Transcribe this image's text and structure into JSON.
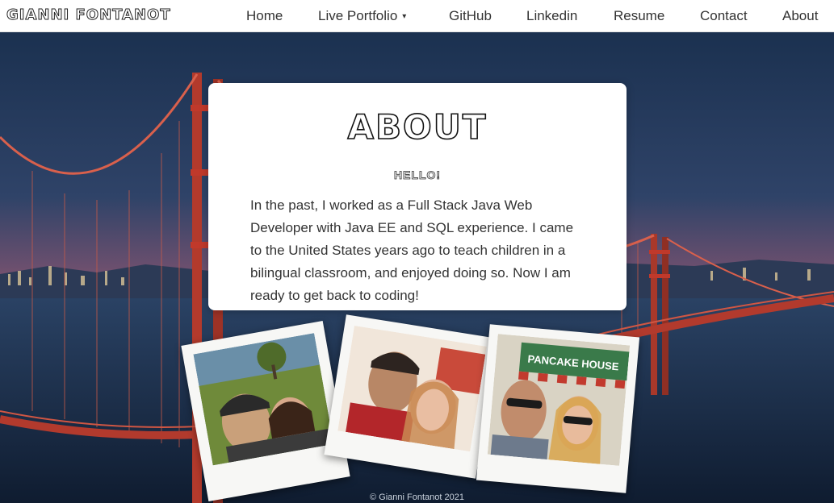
{
  "brand": "GIANNI FONTANOT",
  "nav": {
    "home": "Home",
    "portfolio": "Live Portfolio",
    "github": "GitHub",
    "linkedin": "Linkedin",
    "resume": "Resume",
    "contact": "Contact",
    "about": "About",
    "caret": "▾"
  },
  "about": {
    "title": "ABOUT",
    "greeting": "HELLO!",
    "body": "In the past, I worked as a Full Stack Java Web Developer with Java EE and SQL experience. I came to the United States years ago to teach children in a bilingual classroom, and enjoyed doing so. Now I am ready to get back to coding!"
  },
  "photos": {
    "third_sign": "PANCAKE HOUSE"
  },
  "footer": "© Gianni Fontanot 2021",
  "colors": {
    "nav_bg": "#ffffff",
    "nav_text": "#333333",
    "card_bg": "#ffffff",
    "sky_top": "#1e3553",
    "sunset": "#a1566d",
    "bridge": "#c0392b"
  }
}
